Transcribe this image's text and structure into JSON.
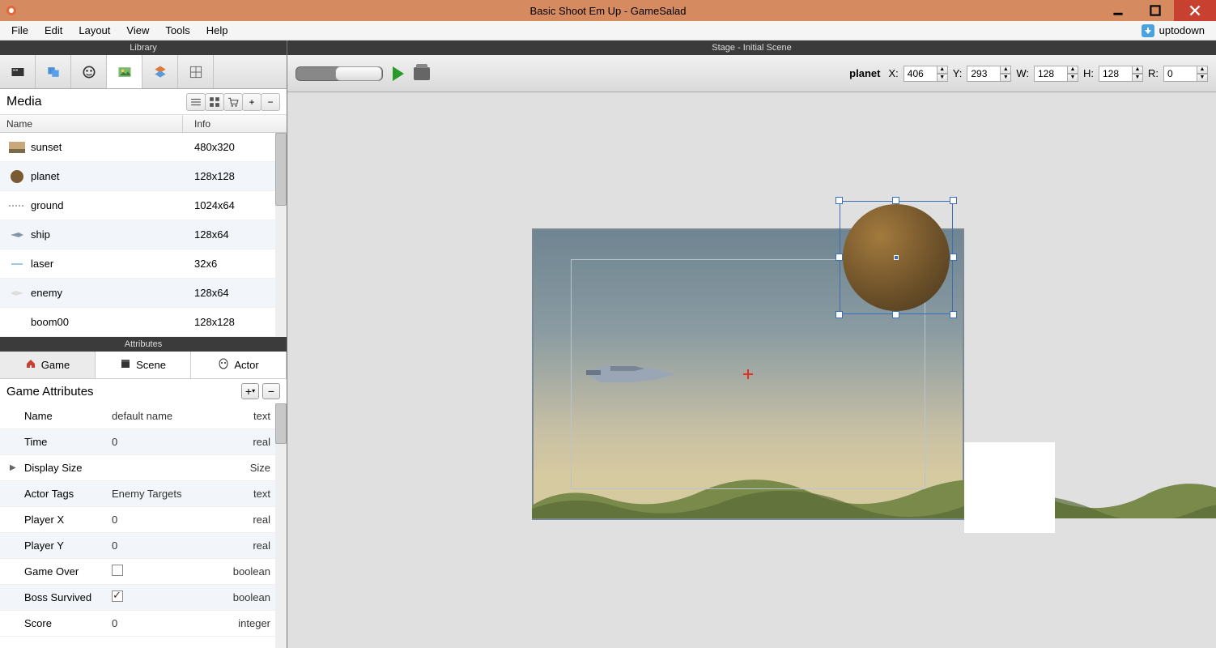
{
  "window": {
    "title": "Basic Shoot Em Up - GameSalad",
    "brand": "uptodown"
  },
  "menu": {
    "items": [
      "File",
      "Edit",
      "Layout",
      "View",
      "Tools",
      "Help"
    ]
  },
  "library": {
    "header": "Library",
    "media_label": "Media",
    "col_name": "Name",
    "col_info": "Info",
    "rows": [
      {
        "name": "sunset",
        "info": "480x320",
        "icon": "sunset"
      },
      {
        "name": "planet",
        "info": "128x128",
        "icon": "planet"
      },
      {
        "name": "ground",
        "info": "1024x64",
        "icon": "ground"
      },
      {
        "name": "ship",
        "info": "128x64",
        "icon": "ship"
      },
      {
        "name": "laser",
        "info": "32x6",
        "icon": "laser"
      },
      {
        "name": "enemy",
        "info": "128x64",
        "icon": "enemy"
      },
      {
        "name": "boom00",
        "info": "128x128",
        "icon": "boom"
      }
    ]
  },
  "attributes": {
    "header": "Attributes",
    "tabs": {
      "game": "Game",
      "scene": "Scene",
      "actor": "Actor"
    },
    "section_title": "Game Attributes",
    "rows": [
      {
        "name": "Name",
        "value": "default name",
        "type": "text",
        "ctrl": "text"
      },
      {
        "name": "Time",
        "value": "0",
        "type": "real",
        "ctrl": "text"
      },
      {
        "name": "Display Size",
        "value": "",
        "type": "Size",
        "ctrl": "expand"
      },
      {
        "name": "Actor Tags",
        "value": "Enemy Targets",
        "type": "text",
        "ctrl": "text"
      },
      {
        "name": "Player X",
        "value": "0",
        "type": "real",
        "ctrl": "text"
      },
      {
        "name": "Player Y",
        "value": "0",
        "type": "real",
        "ctrl": "text"
      },
      {
        "name": "Game Over",
        "value": "",
        "type": "boolean",
        "ctrl": "check-off"
      },
      {
        "name": "Boss Survived",
        "value": "",
        "type": "boolean",
        "ctrl": "check-on"
      },
      {
        "name": "Score",
        "value": "0",
        "type": "integer",
        "ctrl": "text"
      }
    ]
  },
  "stage": {
    "header": "Stage - Initial Scene",
    "selection_name": "planet",
    "coords": {
      "x_label": "X:",
      "x": "406",
      "y_label": "Y:",
      "y": "293",
      "w_label": "W:",
      "w": "128",
      "h_label": "H:",
      "h": "128",
      "r_label": "R:",
      "r": "0"
    }
  }
}
